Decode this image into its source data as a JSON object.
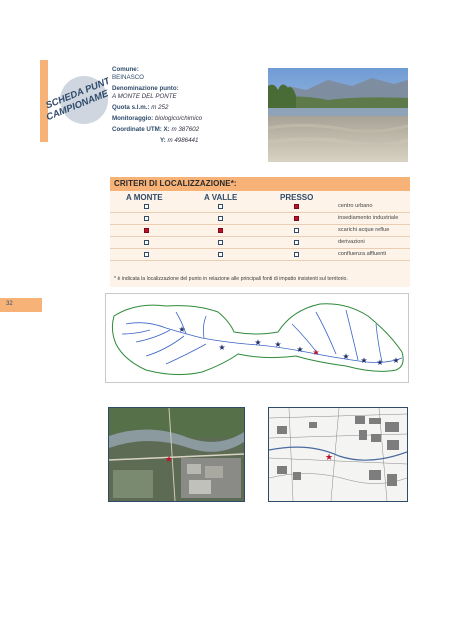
{
  "badge": {
    "line1": "SCHEDA PUNTO",
    "line2": "CAMPIONAMENTO",
    "number": "1"
  },
  "info": {
    "comune_label": "Comune:",
    "comune_value": "BEINASCO",
    "denominazione_label": "Denominazione punto:",
    "denominazione_value": "A MONTE DEL PONTE",
    "quota_label": "Quota s.l.m.:",
    "quota_value": "m 252",
    "monitoraggio_label": "Monitoraggio:",
    "monitoraggio_value": "biologico/chimico",
    "coordinate_label": "Coordinate UTM: X:",
    "x_value": "m 387602",
    "y_label": "Y:",
    "y_value": "m 4986441"
  },
  "criteri": {
    "title": "CRITERI DI LOCALIZZAZIONE*:",
    "col_monte": "A MONTE",
    "col_valle": "A VALLE",
    "col_presso": "PRESSO",
    "rows": [
      {
        "label": "centro urbano",
        "monte": false,
        "valle": false,
        "presso": true
      },
      {
        "label": "insediamento industriale",
        "monte": false,
        "valle": false,
        "presso": true
      },
      {
        "label": "scarichi acque reflue",
        "monte": true,
        "valle": true,
        "presso": false
      },
      {
        "label": "derivazioni",
        "monte": false,
        "valle": false,
        "presso": false
      },
      {
        "label": "confluenza affluenti",
        "monte": false,
        "valle": false,
        "presso": false
      }
    ],
    "note": "* è indicata la localizzazione del punto in relazione alle principali fonti di impatto insistenti sul territorio."
  },
  "page_number": "32",
  "colors": {
    "accent": "#f7b277",
    "navy": "#2f4b6a",
    "marker": "#c0112a",
    "star": "#1e2f6b"
  }
}
